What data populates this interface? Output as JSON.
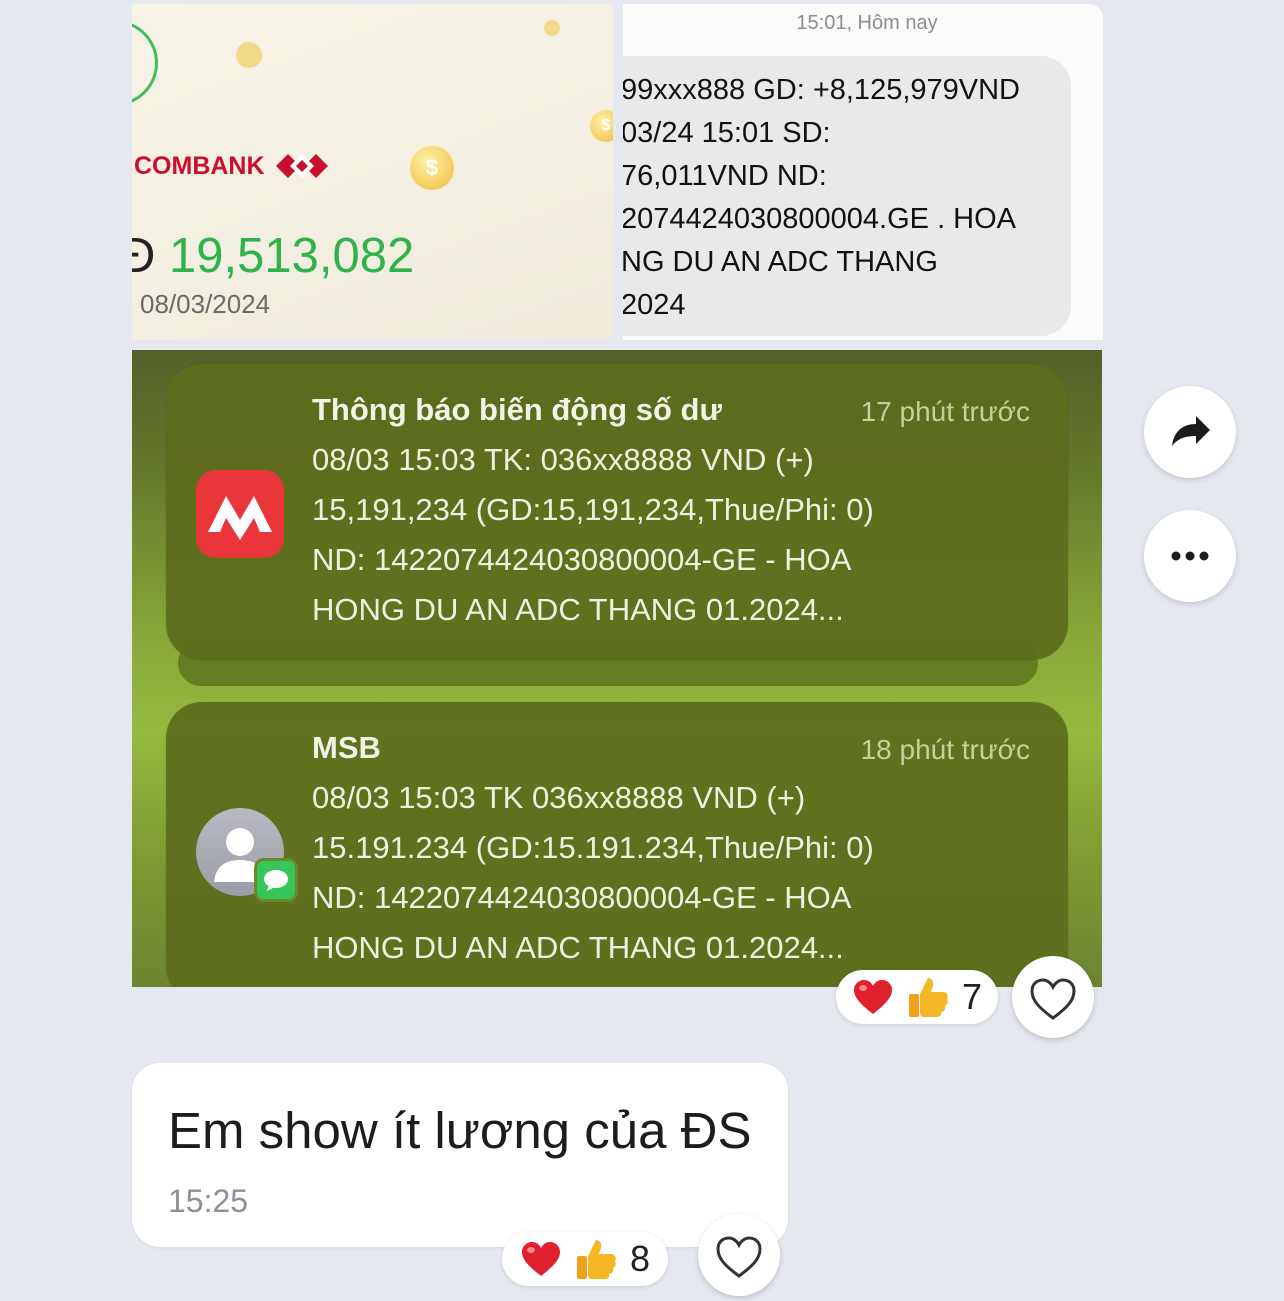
{
  "bank_screenshot": {
    "brand": "COMBANK",
    "amount_prefix": "Đ",
    "amount": "19,513,082",
    "date": "08/03/2024",
    "coin_symbol": "$"
  },
  "sms_screenshot": {
    "time_header": "15:01, Hôm nay",
    "lines": [
      "99xxx888 GD: +8,125,979VND",
      "03/24 15:01  SD:",
      "76,011VND ND:",
      "2074424030800004.GE . HOA",
      "NG DU AN ADC THANG",
      "2024"
    ]
  },
  "notifications": [
    {
      "title": "Thông báo biến động số dư",
      "ago": "17 phút trước",
      "lines": [
        "08/03 15:03 TK: 036xx8888 VND (+)",
        "15,191,234 (GD:15,191,234,Thue/Phi: 0)",
        "ND: 1422074424030800004-GE - HOA",
        "HONG DU AN ADC THANG 01.2024..."
      ]
    },
    {
      "title": "MSB",
      "ago": "18 phút trước",
      "lines": [
        "08/03 15:03 TK 036xx8888 VND (+)",
        "15.191.234 (GD:15.191.234,Thue/Phi: 0)",
        "ND: 1422074424030800004-GE - HOA",
        "HONG DU AN ADC THANG 01.2024..."
      ]
    }
  ],
  "image_reactions": {
    "count": "7",
    "icons": [
      "heart-emoji",
      "thumbs-up-emoji"
    ]
  },
  "text_message": {
    "text": "Em show ít lương của ĐS",
    "time": "15:25"
  },
  "text_reactions": {
    "count": "8",
    "icons": [
      "heart-emoji",
      "thumbs-up-emoji"
    ]
  },
  "actions": {
    "share_icon": "share-arrow-icon",
    "more_icon": "more-dots-icon"
  },
  "colors": {
    "chat_background": "#e5e8ef",
    "techcombank_red": "#c8102e",
    "amount_green": "#2fb34a",
    "notification_card": "#5c6c1c",
    "msb_icon_red": "#e8363a",
    "imessage_green": "#35c759"
  }
}
